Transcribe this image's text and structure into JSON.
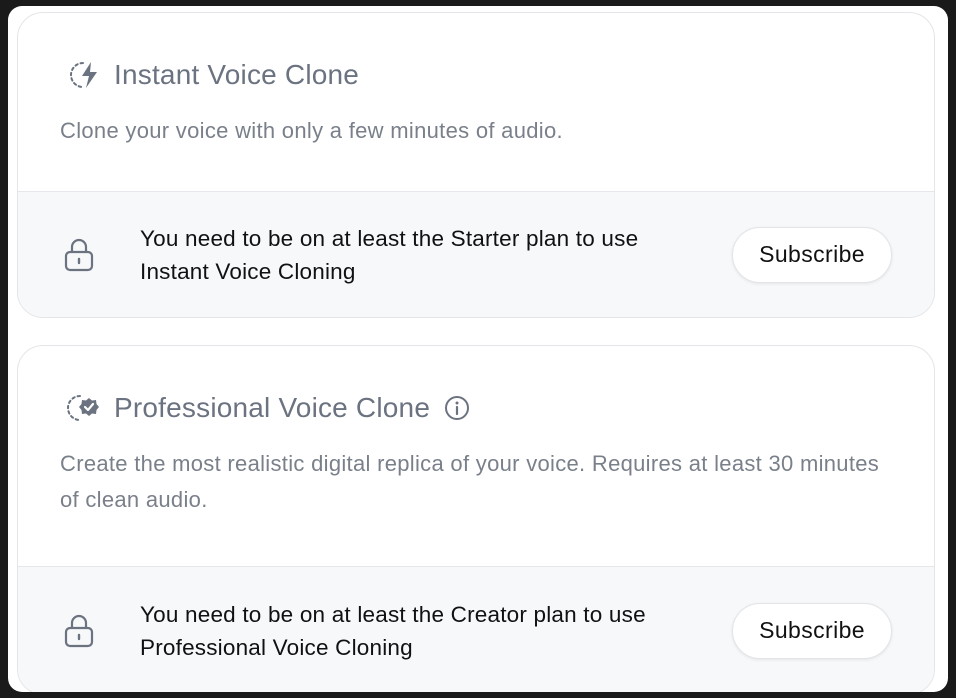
{
  "instant": {
    "title": "Instant Voice Clone",
    "description": "Clone your voice with only a few minutes of audio.",
    "icon": "lightning-dotted-circle-icon",
    "notice": "You need to be on at least the Starter plan to use Instant Voice Cloning",
    "button_label": "Subscribe"
  },
  "professional": {
    "title": "Professional Voice Clone",
    "description": "Create the most realistic digital replica of your voice. Requires at least 30 minutes of clean audio.",
    "icon": "verified-badge-dotted-circle-icon",
    "info_icon": "info-icon",
    "notice": "You need to be on at least the Creator plan to use Professional Voice Cloning",
    "button_label": "Subscribe"
  },
  "colors": {
    "title": "#6b7280",
    "description": "#7a808a",
    "footer_bg": "#f7f8fa",
    "text": "#111111"
  }
}
